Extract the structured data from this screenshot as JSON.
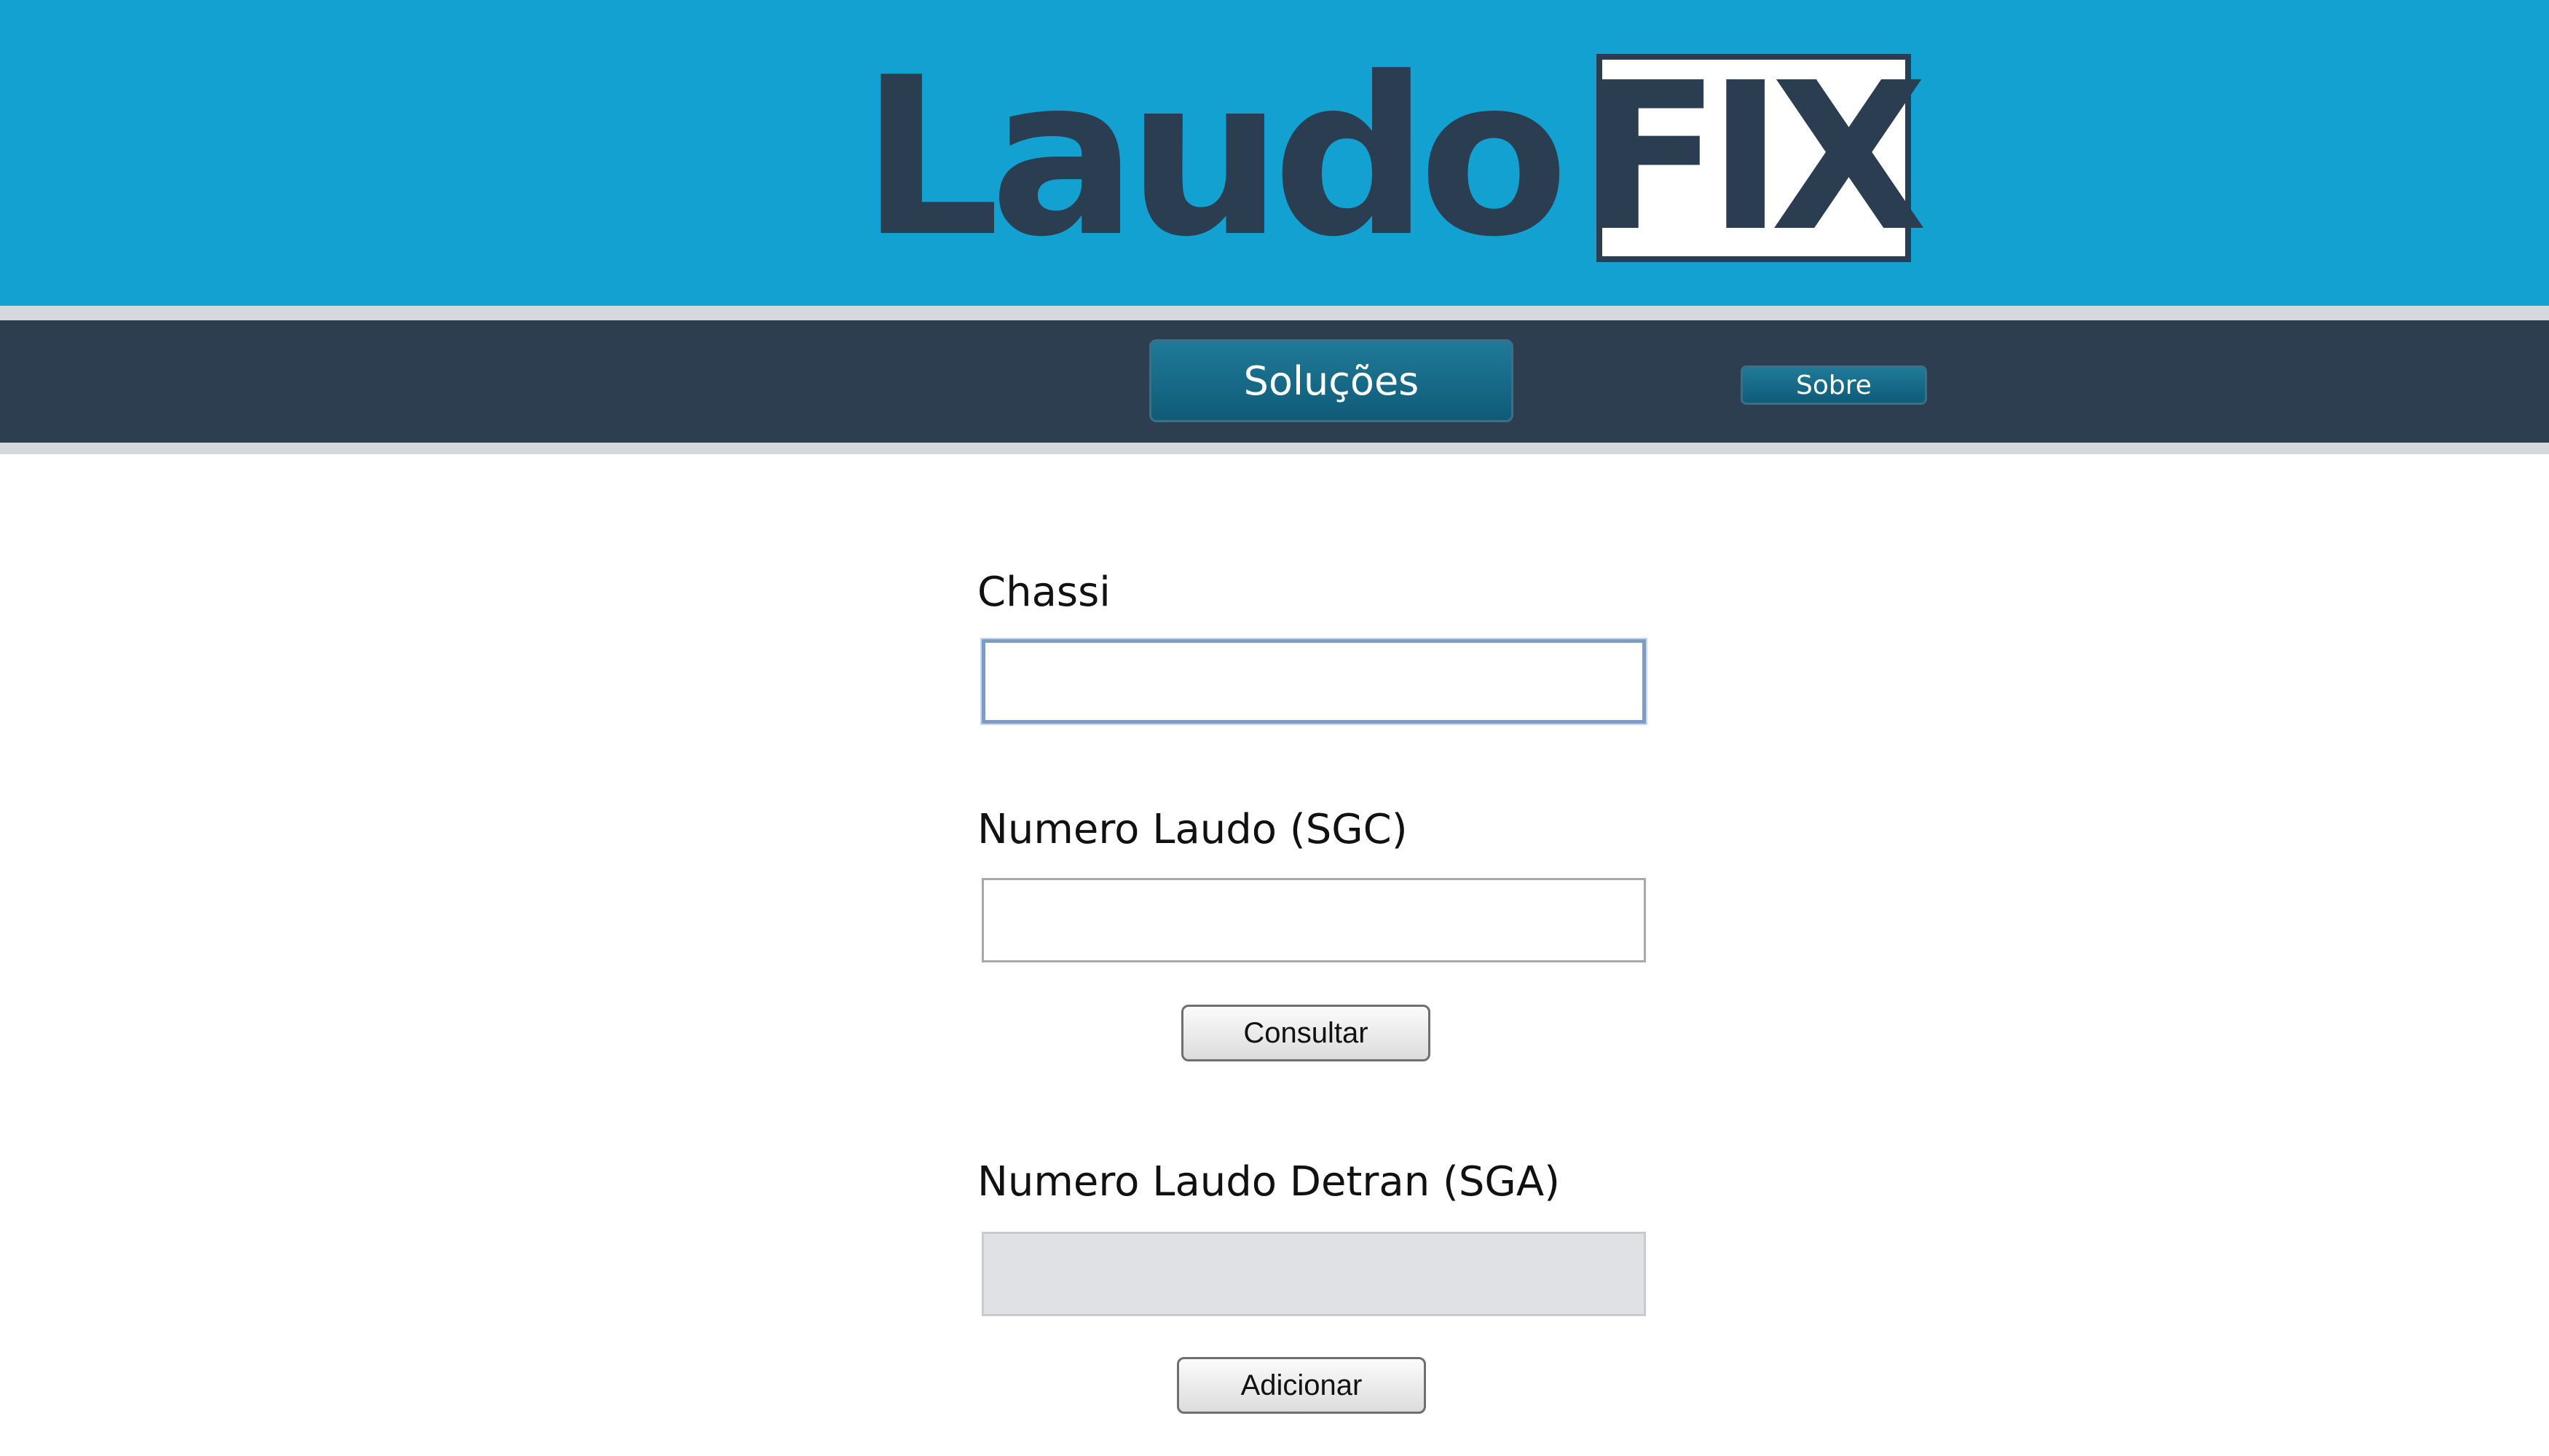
{
  "header": {
    "logo_word": "Laudo",
    "logo_box_word": "FIX",
    "background_color": "#12a1d1",
    "logo_color": "#2b3e51"
  },
  "nav": {
    "background_color": "#2c3e50",
    "items": [
      {
        "label": "Soluções"
      },
      {
        "label": "Sobre"
      }
    ]
  },
  "form": {
    "chassi": {
      "label": "Chassi",
      "value": "",
      "focused": true
    },
    "numero_laudo_sgc": {
      "label": "Numero Laudo (SGC)",
      "value": ""
    },
    "consultar_label": "Consultar",
    "numero_laudo_detran_sga": {
      "label": "Numero Laudo Detran (SGA)",
      "value": "",
      "disabled": true
    },
    "adicionar_label": "Adicionar"
  }
}
